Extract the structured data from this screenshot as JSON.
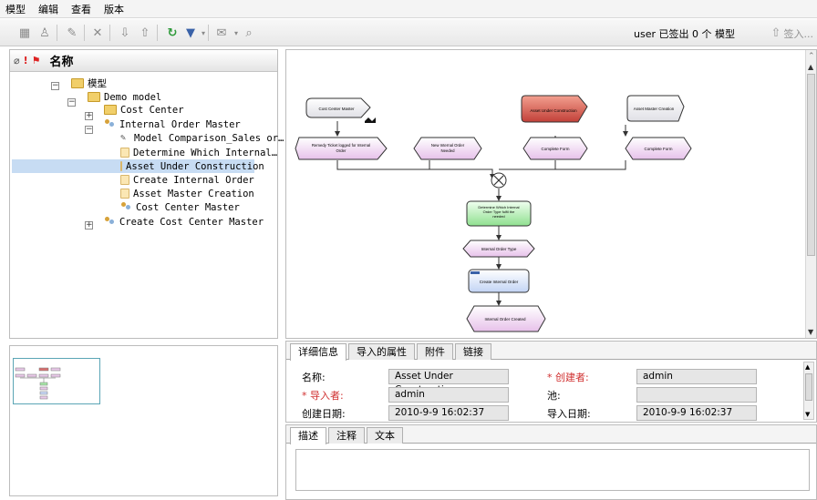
{
  "menu": [
    "模型",
    "编辑",
    "查看",
    "版本"
  ],
  "toolbar": {
    "status": "user 已签出 0 个 模型",
    "signin": "签入..."
  },
  "tree": {
    "header_title": "名称",
    "rows": [
      {
        "label": "模型",
        "indent": 0
      },
      {
        "label": "Demo model",
        "indent": 1
      },
      {
        "label": "Cost Center",
        "indent": 2
      },
      {
        "label": "Internal Order Master",
        "indent": 2
      },
      {
        "label": "Model Comparison_Sales or…",
        "indent": 3
      },
      {
        "label": "Determine Which Internal…",
        "indent": 3
      },
      {
        "label": "Asset Under Construction",
        "indent": 3
      },
      {
        "label": "Create Internal Order",
        "indent": 3
      },
      {
        "label": "Asset Master Creation",
        "indent": 3
      },
      {
        "label": "Cost Center Master",
        "indent": 3
      },
      {
        "label": "Create Cost Center Master",
        "indent": 2
      }
    ]
  },
  "diagram": {
    "nodes": {
      "cost_center_master": "Cost Center Master",
      "asset_under_construction": "Asset Under Construction",
      "asset_master_creation": "Asset Master Creation",
      "remedy_ticket": "Remedy Ticket logged for Internal Order",
      "new_internal_order": "New Internal Order Needed",
      "complete_form_1": "Complete Form",
      "complete_form_2": "Complete Form",
      "determine_type": "Determine Which Internal Order Type fulfill the needed",
      "internal_order_type": "Internal Order Type",
      "create_internal_order": "Create Internal Order",
      "internal_order_created": "Internal Order Created"
    }
  },
  "details": {
    "tabs": [
      "详细信息",
      "导入的属性",
      "附件",
      "链接"
    ],
    "fields": {
      "name_label": "名称:",
      "name_value": "Asset Under Construction",
      "creator_label": "* 创建者:",
      "creator_value": "admin",
      "importer_label": "* 导入者:",
      "importer_value": "admin",
      "pool_label": "池:",
      "pool_value": "",
      "created_date_label": "创建日期:",
      "created_date_value": "2010-9-9 16:02:37",
      "import_date_label": "导入日期:",
      "import_date_value": "2010-9-9 16:02:37"
    }
  },
  "desc": {
    "tabs": [
      "描述",
      "注释",
      "文本"
    ]
  }
}
